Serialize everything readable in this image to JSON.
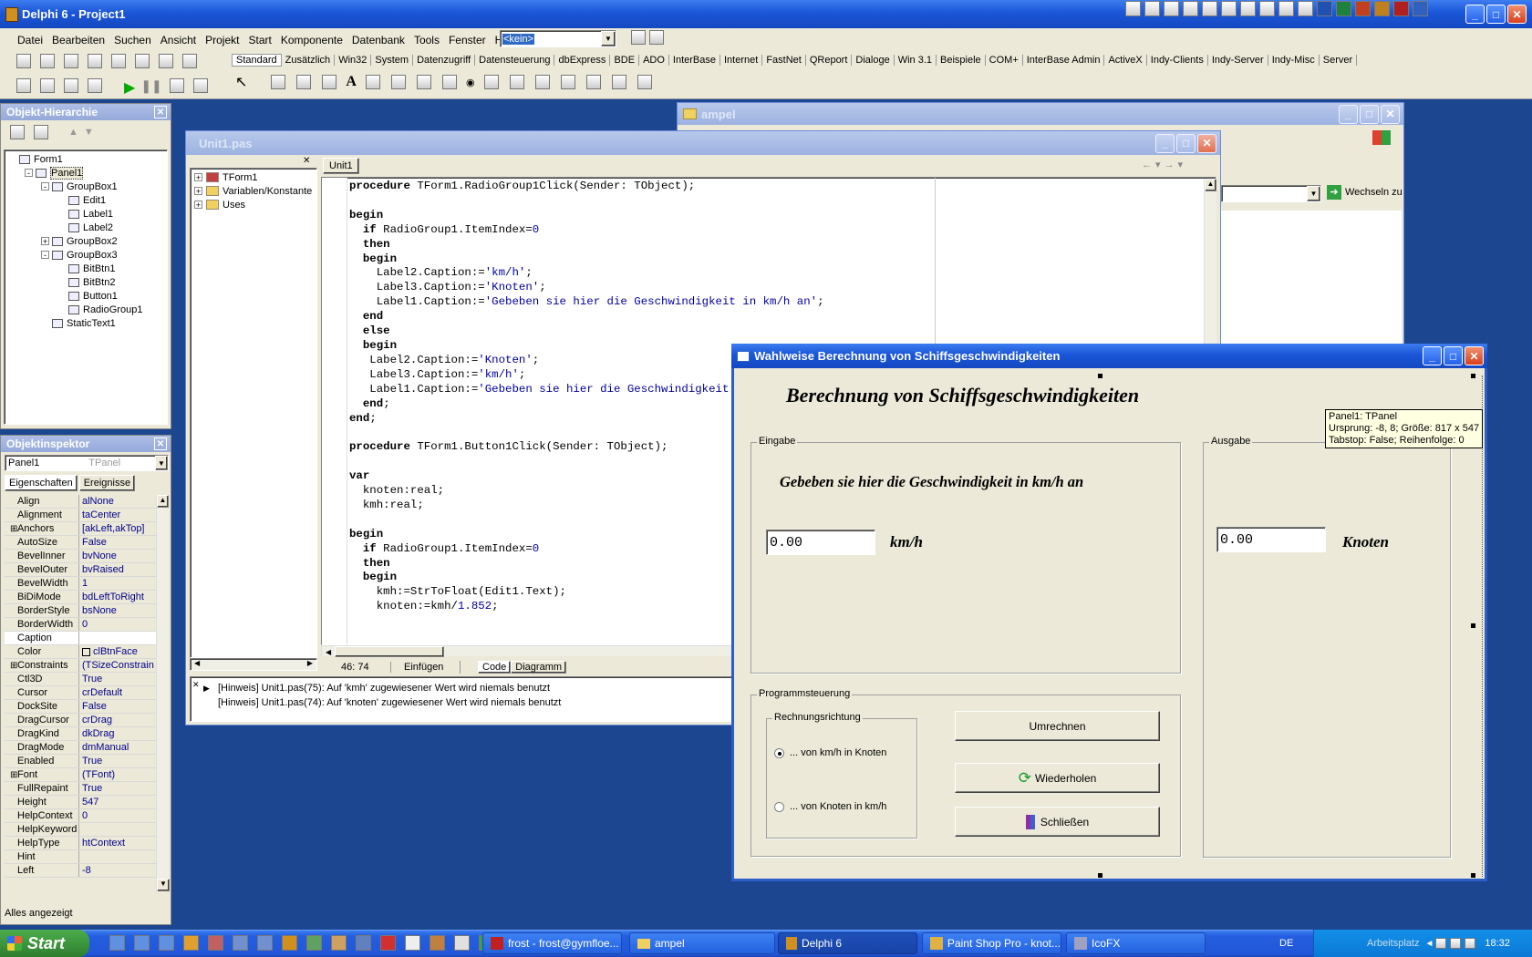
{
  "main": {
    "title": "Delphi 6 - Project1",
    "menu": [
      "Datei",
      "Bearbeiten",
      "Suchen",
      "Ansicht",
      "Projekt",
      "Start",
      "Komponente",
      "Datenbank",
      "Tools",
      "Fenster",
      "Hilfe"
    ],
    "config_combo": "<kein>",
    "palette_tabs": [
      "Standard",
      "Zusätzlich",
      "Win32",
      "System",
      "Datenzugriff",
      "Datensteuerung",
      "dbExpress",
      "BDE",
      "ADO",
      "InterBase",
      "Internet",
      "FastNet",
      "QReport",
      "Dialoge",
      "Win 3.1",
      "Beispiele",
      "COM+",
      "InterBase Admin",
      "ActiveX",
      "Indy-Clients",
      "Indy-Server",
      "Indy-Misc",
      "Server"
    ]
  },
  "hierarchy": {
    "title": "Objekt-Hierarchie",
    "items": [
      {
        "label": "Form1",
        "level": 0,
        "exp": ""
      },
      {
        "label": "Panel1",
        "level": 1,
        "exp": "-"
      },
      {
        "label": "GroupBox1",
        "level": 2,
        "exp": "-"
      },
      {
        "label": "Edit1",
        "level": 3,
        "exp": ""
      },
      {
        "label": "Label1",
        "level": 3,
        "exp": ""
      },
      {
        "label": "Label2",
        "level": 3,
        "exp": ""
      },
      {
        "label": "GroupBox2",
        "level": 2,
        "exp": "+"
      },
      {
        "label": "GroupBox3",
        "level": 2,
        "exp": "-"
      },
      {
        "label": "BitBtn1",
        "level": 3,
        "exp": ""
      },
      {
        "label": "BitBtn2",
        "level": 3,
        "exp": ""
      },
      {
        "label": "Button1",
        "level": 3,
        "exp": ""
      },
      {
        "label": "RadioGroup1",
        "level": 3,
        "exp": ""
      },
      {
        "label": "StaticText1",
        "level": 2,
        "exp": ""
      }
    ]
  },
  "inspector": {
    "title": "Objektinspektor",
    "object": "Panel1",
    "object_type": "TPanel",
    "tab_props": "Eigenschaften",
    "tab_events": "Ereignisse",
    "status": "Alles angezeigt",
    "props": [
      {
        "n": "Align",
        "v": "alNone",
        "plus": false
      },
      {
        "n": "Alignment",
        "v": "taCenter",
        "plus": false
      },
      {
        "n": "Anchors",
        "v": "[akLeft,akTop]",
        "plus": true
      },
      {
        "n": "AutoSize",
        "v": "False",
        "plus": false
      },
      {
        "n": "BevelInner",
        "v": "bvNone",
        "plus": false
      },
      {
        "n": "BevelOuter",
        "v": "bvRaised",
        "plus": false
      },
      {
        "n": "BevelWidth",
        "v": "1",
        "plus": false
      },
      {
        "n": "BiDiMode",
        "v": "bdLeftToRight",
        "plus": false
      },
      {
        "n": "BorderStyle",
        "v": "bsNone",
        "plus": false
      },
      {
        "n": "BorderWidth",
        "v": "0",
        "plus": false
      },
      {
        "n": "Caption",
        "v": "",
        "plus": false,
        "sel": true
      },
      {
        "n": "Color",
        "v": "clBtnFace",
        "plus": false,
        "swatch": true
      },
      {
        "n": "Constraints",
        "v": "(TSizeConstrain",
        "plus": true
      },
      {
        "n": "Ctl3D",
        "v": "True",
        "plus": false
      },
      {
        "n": "Cursor",
        "v": "crDefault",
        "plus": false
      },
      {
        "n": "DockSite",
        "v": "False",
        "plus": false
      },
      {
        "n": "DragCursor",
        "v": "crDrag",
        "plus": false
      },
      {
        "n": "DragKind",
        "v": "dkDrag",
        "plus": false
      },
      {
        "n": "DragMode",
        "v": "dmManual",
        "plus": false
      },
      {
        "n": "Enabled",
        "v": "True",
        "plus": false
      },
      {
        "n": "Font",
        "v": "(TFont)",
        "plus": true
      },
      {
        "n": "FullRepaint",
        "v": "True",
        "plus": false
      },
      {
        "n": "Height",
        "v": "547",
        "plus": false
      },
      {
        "n": "HelpContext",
        "v": "0",
        "plus": false
      },
      {
        "n": "HelpKeyword",
        "v": "",
        "plus": false
      },
      {
        "n": "HelpType",
        "v": "htContext",
        "plus": false
      },
      {
        "n": "Hint",
        "v": "",
        "plus": false
      },
      {
        "n": "Left",
        "v": "-8",
        "plus": false
      }
    ]
  },
  "editor": {
    "title": "Unit1.pas",
    "tab": "Unit1",
    "explorer": [
      "TForm1",
      "Variablen/Konstante",
      "Uses"
    ],
    "status_pos": "46: 74",
    "status_mode": "Einfügen",
    "tab_code": "Code",
    "tab_diagram": "Diagramm",
    "messages": [
      "[Hinweis] Unit1.pas(75): Auf 'kmh' zugewiesener Wert wird niemals benutzt",
      "[Hinweis] Unit1.pas(74): Auf 'knoten' zugewiesener Wert wird niemals benutzt"
    ]
  },
  "explorer_window": {
    "title": "ampel",
    "goto": "Wechseln zu"
  },
  "form": {
    "title": "Wahlweise Berechnung von Schiffsgeschwindigkeiten",
    "heading": "Berechnung von Schiffsgeschwindigkeiten",
    "hint_lines": [
      "Panel1: TPanel",
      "Ursprung: -8, 8; Größe: 817 x 547",
      "Tabstop: False; Reihenfolge: 0"
    ],
    "eingabe": "Eingabe",
    "ausgabe": "Ausgabe",
    "prompt": "Gebeben sie hier die Geschwindigkeit in km/h an",
    "edit1": "0.00",
    "unit_in": "km/h",
    "edit2": "0.00",
    "unit_out": "Knoten",
    "program_group": "Programmsteuerung",
    "radio_group": "Rechnungsrichtung",
    "radio1": "... von km/h in Knoten",
    "radio2": "... von Knoten in km/h",
    "btn_convert": "Umrechnen",
    "btn_repeat": "Wiederholen",
    "btn_close": "Schließen"
  },
  "taskbar": {
    "start": "Start",
    "tasks": [
      "frost - frost@gymfloe...",
      "ampel",
      "Delphi 6",
      "Paint Shop Pro - knot...",
      "IcoFX"
    ],
    "lang": "DE",
    "place": "Arbeitsplatz",
    "clock": "18:32"
  }
}
